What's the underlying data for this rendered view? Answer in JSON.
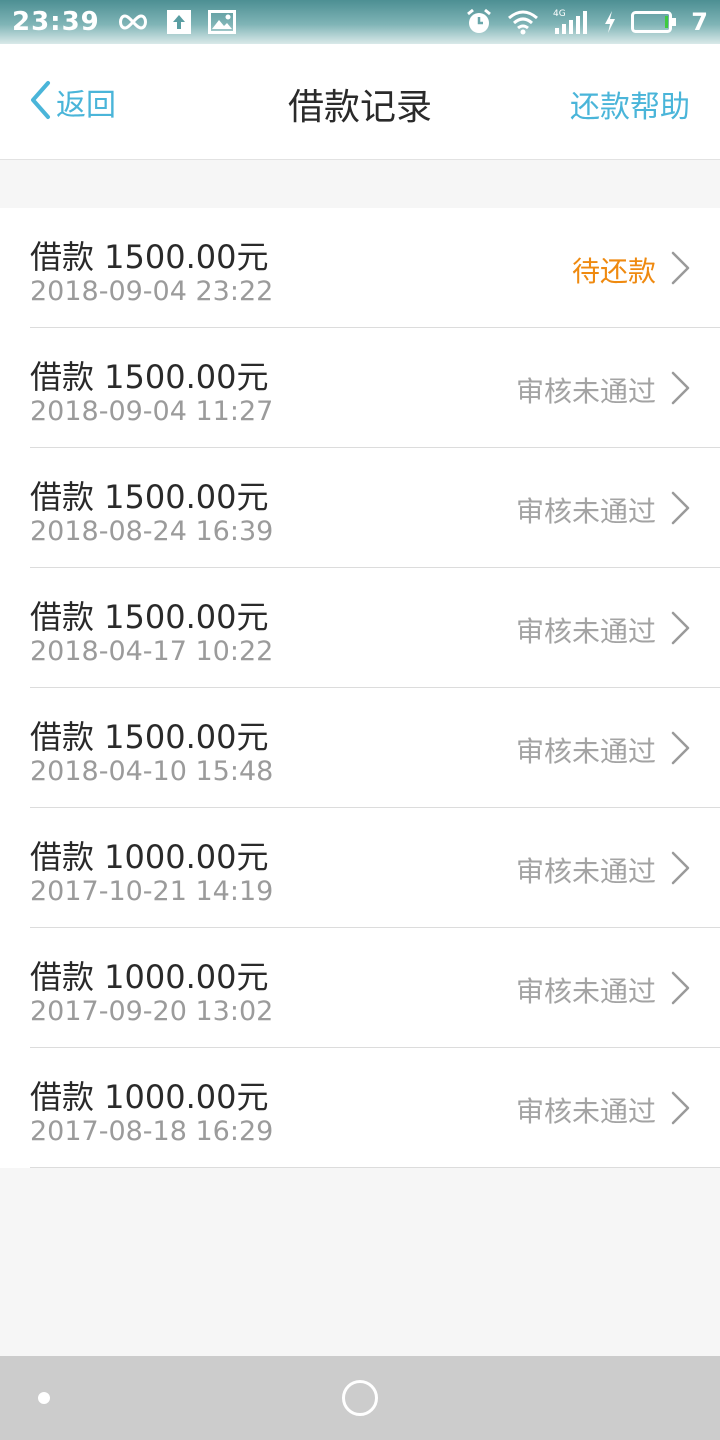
{
  "status_bar": {
    "time": "23:39",
    "battery_level": "7",
    "icons": [
      "infinity-icon",
      "upload-icon",
      "image-icon",
      "alarm-icon",
      "wifi-icon",
      "signal-4g-icon",
      "charging-icon",
      "battery-icon"
    ]
  },
  "header": {
    "back_label": "返回",
    "title": "借款记录",
    "help_label": "还款帮助"
  },
  "records": [
    {
      "amount": "借款 1500.00元",
      "date": "2018-09-04 23:22",
      "status": "待还款",
      "status_type": "pending"
    },
    {
      "amount": "借款 1500.00元",
      "date": "2018-09-04 11:27",
      "status": "审核未通过",
      "status_type": "rejected"
    },
    {
      "amount": "借款 1500.00元",
      "date": "2018-08-24 16:39",
      "status": "审核未通过",
      "status_type": "rejected"
    },
    {
      "amount": "借款 1500.00元",
      "date": "2018-04-17 10:22",
      "status": "审核未通过",
      "status_type": "rejected"
    },
    {
      "amount": "借款 1500.00元",
      "date": "2018-04-10 15:48",
      "status": "审核未通过",
      "status_type": "rejected"
    },
    {
      "amount": "借款 1000.00元",
      "date": "2017-10-21 14:19",
      "status": "审核未通过",
      "status_type": "rejected"
    },
    {
      "amount": "借款 1000.00元",
      "date": "2017-09-20 13:02",
      "status": "审核未通过",
      "status_type": "rejected"
    },
    {
      "amount": "借款 1000.00元",
      "date": "2017-08-18 16:29",
      "status": "审核未通过",
      "status_type": "rejected"
    }
  ],
  "colors": {
    "accent": "#4ab5d9",
    "pending": "#ef8a10",
    "rejected": "#a3a3a3"
  }
}
